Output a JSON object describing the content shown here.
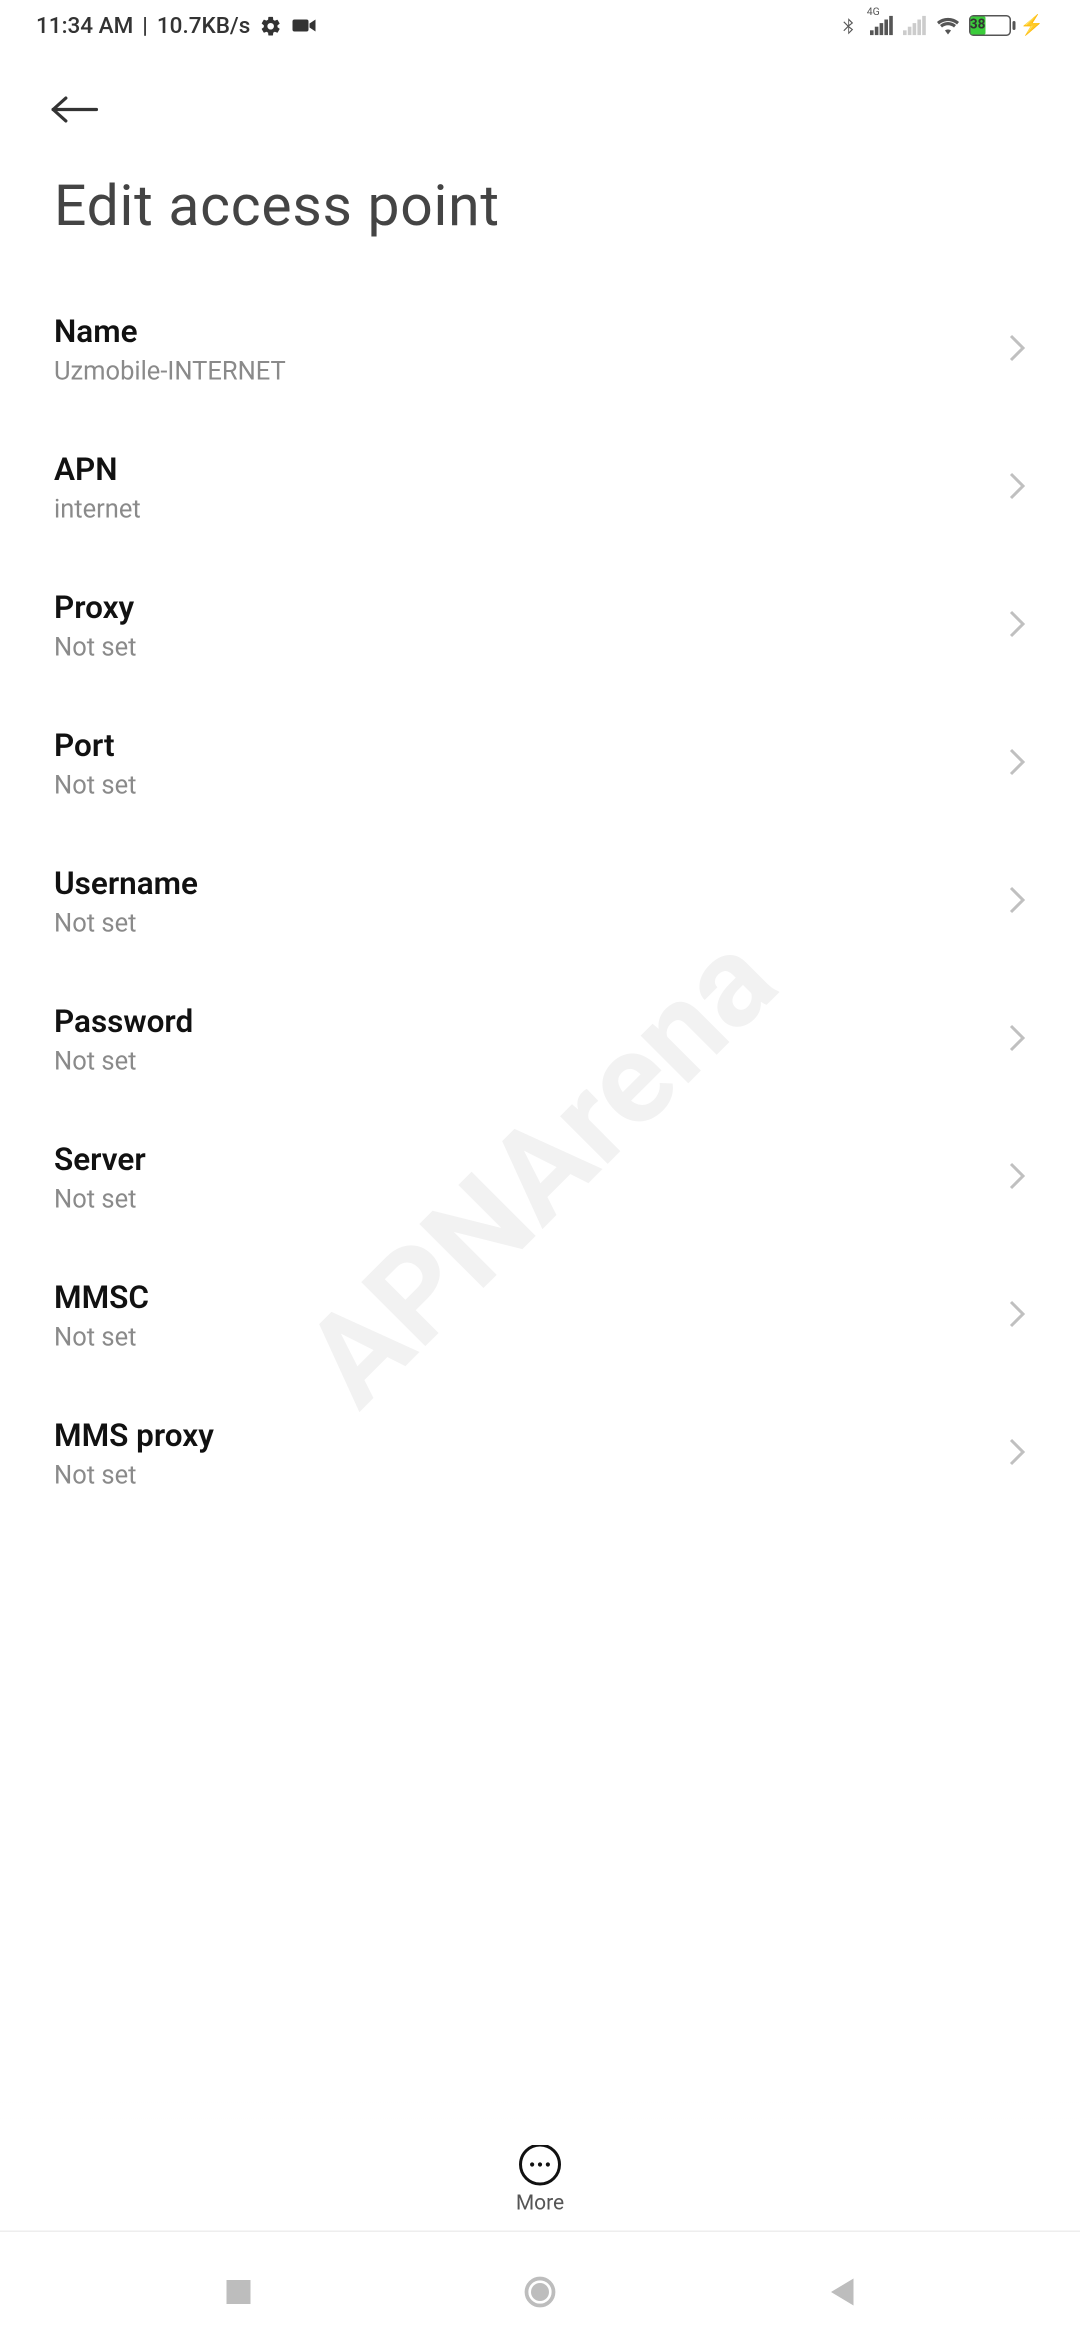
{
  "status": {
    "time": "11:34 AM",
    "separator": "|",
    "net_speed": "10.7KB/s",
    "battery_pct": "38"
  },
  "header": {
    "title": "Edit access point"
  },
  "items": [
    {
      "label": "Name",
      "value": "Uzmobile-INTERNET"
    },
    {
      "label": "APN",
      "value": "internet"
    },
    {
      "label": "Proxy",
      "value": "Not set"
    },
    {
      "label": "Port",
      "value": "Not set"
    },
    {
      "label": "Username",
      "value": "Not set"
    },
    {
      "label": "Password",
      "value": "Not set"
    },
    {
      "label": "Server",
      "value": "Not set"
    },
    {
      "label": "MMSC",
      "value": "Not set"
    },
    {
      "label": "MMS proxy",
      "value": "Not set"
    }
  ],
  "bottom": {
    "more_label": "More"
  },
  "watermark": "APNArena"
}
